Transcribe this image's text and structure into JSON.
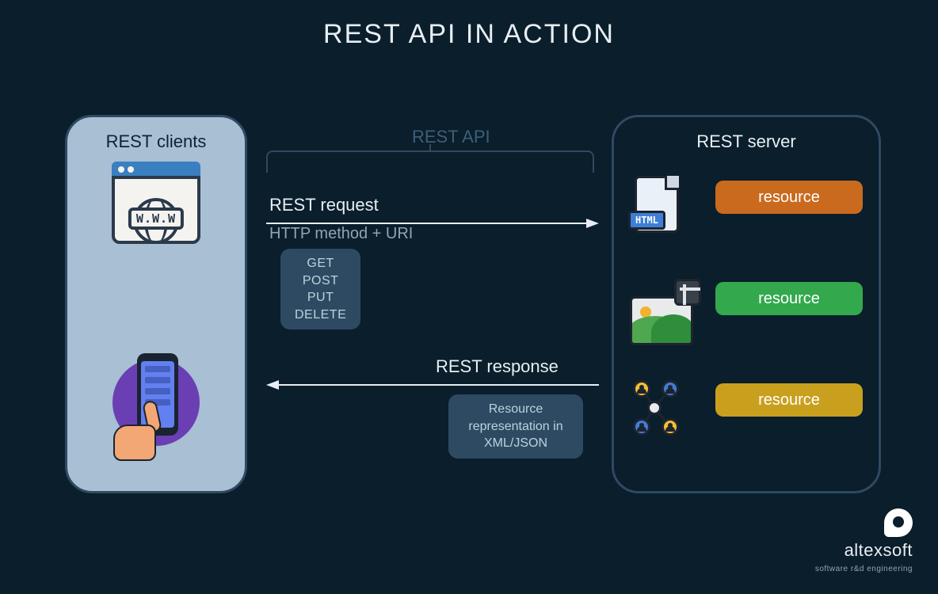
{
  "title": "REST API IN ACTION",
  "clients": {
    "title": "REST clients",
    "www_label": "W.W.W"
  },
  "mid": {
    "api_label": "REST API",
    "request": {
      "label": "REST request",
      "sub": "HTTP method + URI",
      "methods": [
        "GET",
        "POST",
        "PUT",
        "DELETE"
      ]
    },
    "response": {
      "label": "REST response",
      "box": "Resource representation in XML/JSON"
    }
  },
  "server": {
    "title": "REST server",
    "resources": [
      {
        "label": "resource",
        "color": "orange",
        "icon": "html-file"
      },
      {
        "label": "resource",
        "color": "green",
        "icon": "image-file"
      },
      {
        "label": "resource",
        "color": "yellow",
        "icon": "user-network"
      }
    ],
    "html_badge": "HTML"
  },
  "logo": {
    "name": "altexsoft",
    "tagline": "software r&d engineering"
  }
}
